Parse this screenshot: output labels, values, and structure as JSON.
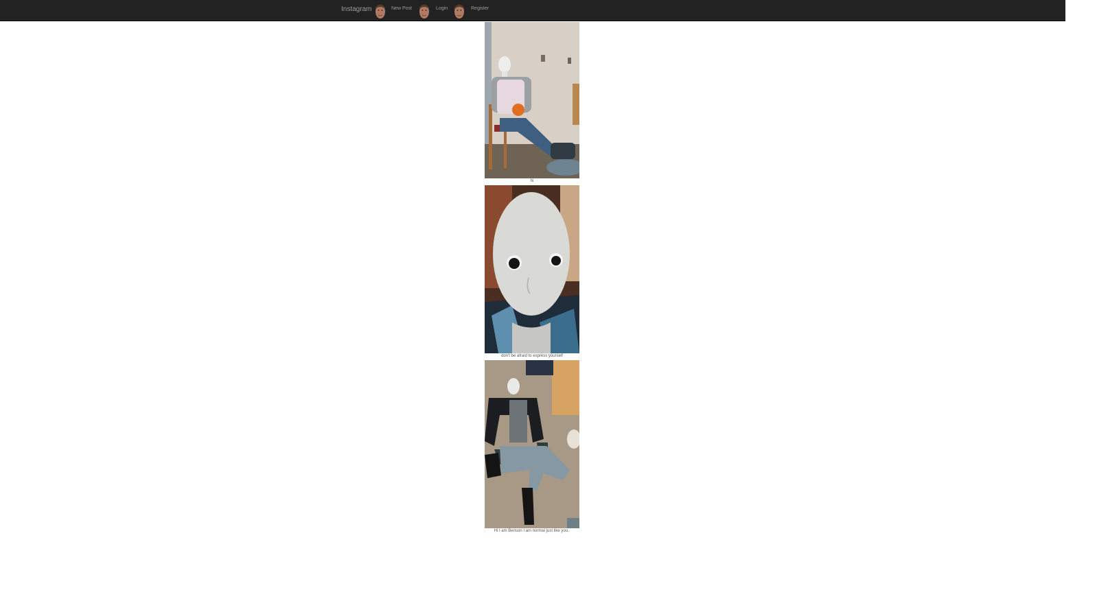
{
  "navbar": {
    "brand": "Instagram",
    "links": [
      {
        "label": "New Post"
      },
      {
        "label": "Login"
      },
      {
        "label": "Register"
      }
    ],
    "avatar_icon": "profile-avatar-icon"
  },
  "posts": [
    {
      "caption": "hi"
    },
    {
      "caption": "don't be afraid to express yourself"
    },
    {
      "caption": "Hi I am Benson I am normal just like you.."
    }
  ],
  "colors": {
    "navbar_bg": "#222222",
    "nav_text": "#9d9d9d",
    "caption_text": "#555555"
  }
}
